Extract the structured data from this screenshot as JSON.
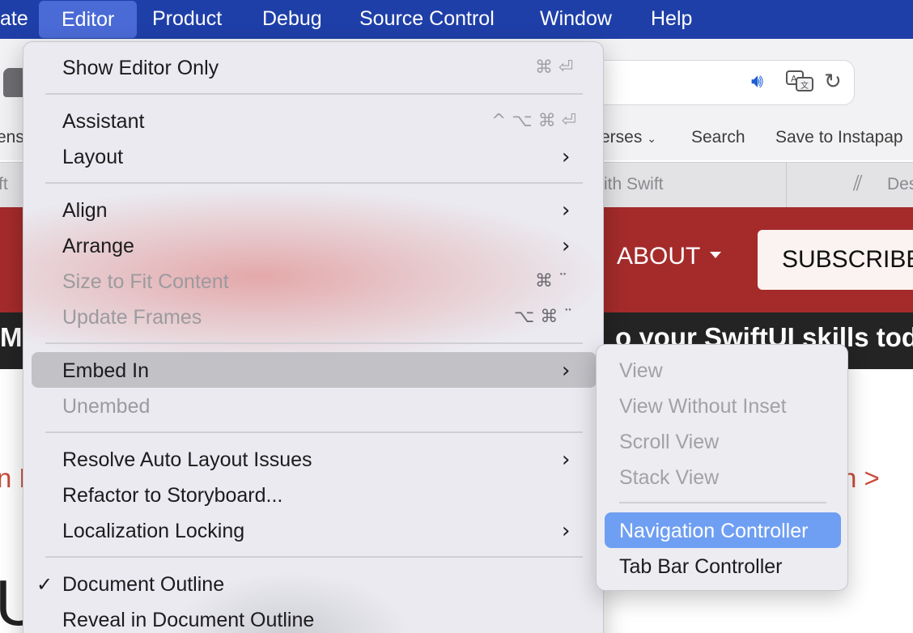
{
  "menubar": {
    "items": [
      {
        "label": "ate"
      },
      {
        "label": "Editor"
      },
      {
        "label": "Product"
      },
      {
        "label": "Debug"
      },
      {
        "label": "Source Control"
      },
      {
        "label": "Window"
      },
      {
        "label": "Help"
      }
    ]
  },
  "browser": {
    "bookmarks": [
      "ens",
      "erses",
      "Search",
      "Save to Instapap"
    ],
    "tabs": [
      "ft",
      "ith Swift",
      "Des"
    ],
    "nav_about": "ABOUT",
    "subscribe": "SUBSCRIBE",
    "banner_left": "My",
    "banner_right": "o your SwiftUI skills tod",
    "red_left": "n F",
    "red_right": "n >",
    "big_letter": "U"
  },
  "editor_menu": {
    "show_editor_only": {
      "label": "Show Editor Only",
      "shortcut": "⌘ ⏎"
    },
    "assistant": {
      "label": "Assistant",
      "shortcut": "^ ⌥ ⌘ ⏎"
    },
    "layout": {
      "label": "Layout"
    },
    "align": {
      "label": "Align"
    },
    "arrange": {
      "label": "Arrange"
    },
    "size_to_fit": {
      "label": "Size to Fit Content",
      "shortcut": "⌘ ¨"
    },
    "update_frames": {
      "label": "Update Frames",
      "shortcut": "⌥ ⌘ ¨"
    },
    "embed_in": {
      "label": "Embed In"
    },
    "unembed": {
      "label": "Unembed"
    },
    "resolve_auto_layout": {
      "label": "Resolve Auto Layout Issues"
    },
    "refactor_storyboard": {
      "label": "Refactor to Storyboard..."
    },
    "localization_locking": {
      "label": "Localization Locking"
    },
    "document_outline": {
      "label": "Document Outline",
      "checked": true
    },
    "reveal_outline": {
      "label": "Reveal in Document Outline"
    }
  },
  "embed_submenu": {
    "items": [
      {
        "label": "View"
      },
      {
        "label": "View Without Inset"
      },
      {
        "label": "Scroll View"
      },
      {
        "label": "Stack View"
      },
      {
        "label": "Navigation Controller"
      },
      {
        "label": "Tab Bar Controller"
      }
    ]
  },
  "colors": {
    "menubar": "#1f3fa8",
    "menubar_active": "#4a6ad6",
    "site_red": "#a52b2b",
    "submenu_selection": "#6f9ff2"
  }
}
